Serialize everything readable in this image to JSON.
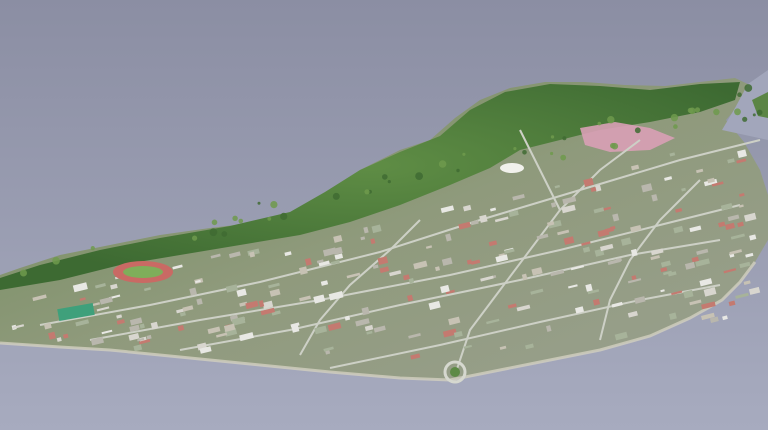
{
  "scene": {
    "description_visible_text": "",
    "palette": {
      "water_top": "#8e91a6",
      "water_bottom": "#a4a8bd",
      "forest_dark": "#3f6b33",
      "forest_light": "#6f9a4c",
      "urban_base": "#9aa08f",
      "road": "#c9cbc4",
      "roof_red": "#c47a70",
      "roof_white": "#e8e8e4",
      "field_red": "#c86a64",
      "field_green": "#4aa07a",
      "pink_district": "#e0a4b8"
    },
    "icons": [
      "roundabout-icon",
      "stadium-icon"
    ]
  }
}
